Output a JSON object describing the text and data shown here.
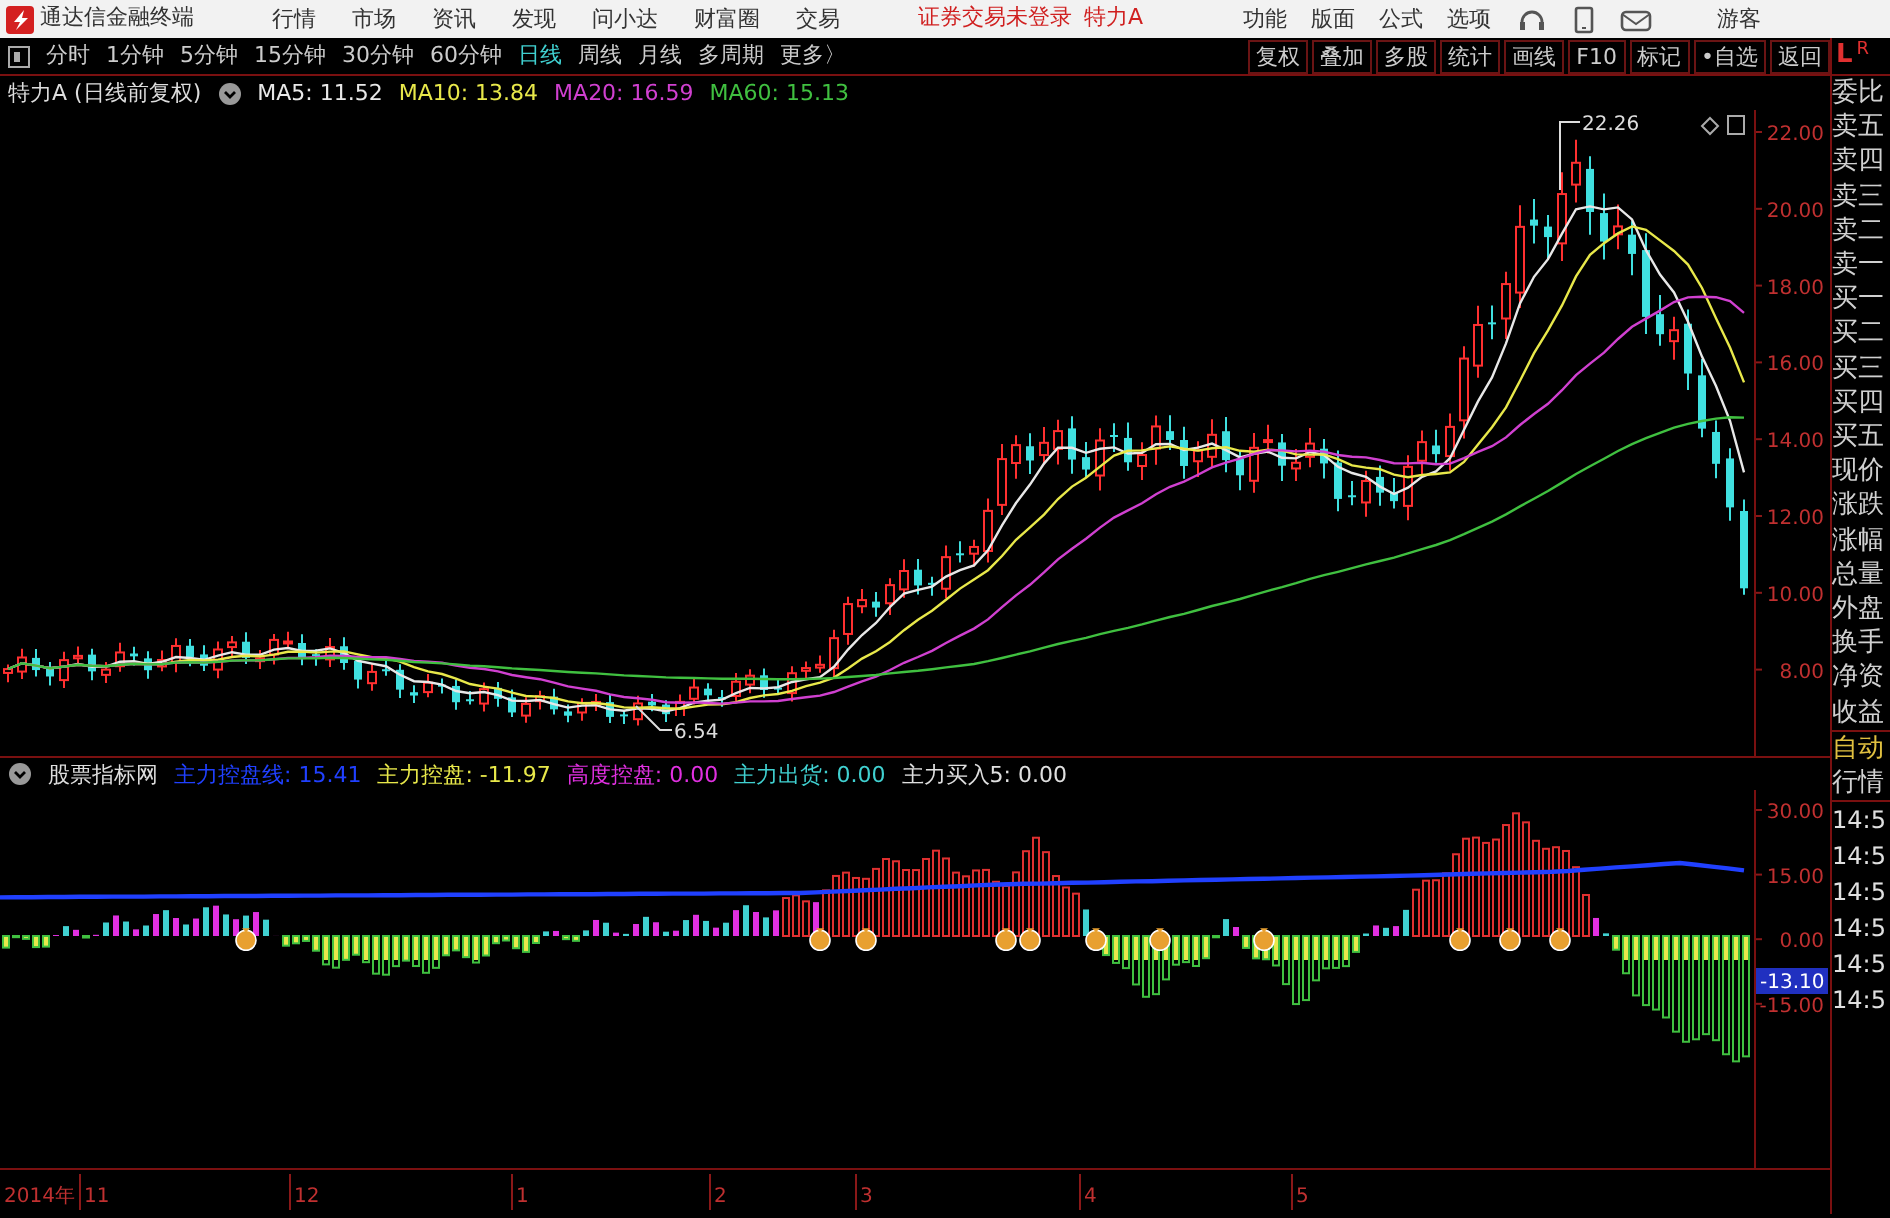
{
  "app_bar": {
    "title": "通达信金融终端",
    "menu": [
      "行情",
      "市场",
      "资讯",
      "发现",
      "问小达",
      "财富圈",
      "交易"
    ],
    "login_status": "证券交易未登录",
    "stock_name": "特力A",
    "tools": [
      "功能",
      "版面",
      "公式",
      "选项"
    ],
    "user": "游客"
  },
  "period_bar": {
    "periods": [
      {
        "label": "分时",
        "selected": false
      },
      {
        "label": "1分钟",
        "selected": false
      },
      {
        "label": "5分钟",
        "selected": false
      },
      {
        "label": "15分钟",
        "selected": false
      },
      {
        "label": "30分钟",
        "selected": false
      },
      {
        "label": "60分钟",
        "selected": false
      },
      {
        "label": "日线",
        "selected": true
      },
      {
        "label": "周线",
        "selected": false
      },
      {
        "label": "月线",
        "selected": false
      },
      {
        "label": "多周期",
        "selected": false
      }
    ],
    "more": "更多〉",
    "chart_buttons": [
      "复权",
      "叠加",
      "多股",
      "统计",
      "画线",
      "F10",
      "标记",
      "•自选",
      "返回"
    ]
  },
  "price_pane": {
    "title": "特力A (日线前复权)",
    "ma": [
      {
        "label": "MA5: 11.52",
        "color": "#e8e8e8"
      },
      {
        "label": "MA10: 13.84",
        "color": "#e8e84a"
      },
      {
        "label": "MA20: 16.59",
        "color": "#d040d0"
      },
      {
        "label": "MA60: 15.13",
        "color": "#40c040"
      }
    ],
    "y_ticks": [
      "22.00",
      "20.00",
      "18.00",
      "16.00",
      "14.00",
      "12.00",
      "10.00",
      "8.00"
    ],
    "high_label": "22.26",
    "low_label": "6.54"
  },
  "indicator_pane": {
    "name": "股票指标网",
    "values": [
      {
        "label": "主力控盘线: 15.41",
        "color": "#2040ff"
      },
      {
        "label": "主力控盘: -11.97",
        "color": "#e8e84a"
      },
      {
        "label": "高度控盘: 0.00",
        "color": "#e030e0"
      },
      {
        "label": "主力出货: 0.00",
        "color": "#40d0d0"
      },
      {
        "label": "主力买入5: 0.00",
        "color": "#e0e0e0"
      }
    ],
    "y_ticks": [
      "30.00",
      "15.00",
      "0.00",
      "-15.00"
    ],
    "current_value": "-13.10"
  },
  "date_axis": [
    "2014年",
    "11",
    "12",
    "1",
    "2",
    "3",
    "4",
    "5"
  ],
  "quote_panel": {
    "header_left": "L",
    "header_right": "R",
    "labels": [
      "委比",
      "卖五",
      "卖四",
      "卖三",
      "卖二",
      "卖一",
      "买一",
      "买二",
      "买三",
      "买四",
      "买五",
      "现价",
      "涨跌",
      "涨幅",
      "总量",
      "外盘",
      "换手",
      "净资",
      "收益"
    ],
    "mode": "自动",
    "mode_2": "行情",
    "times": [
      "14:5",
      "14:5",
      "14:5",
      "14:5",
      "14:5",
      "14:5"
    ]
  }
}
